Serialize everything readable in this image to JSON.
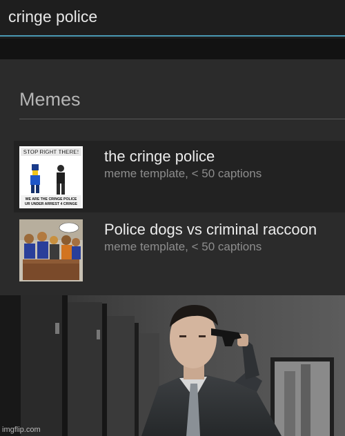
{
  "search": {
    "value": "cringe police"
  },
  "section": {
    "title": "Memes"
  },
  "results": [
    {
      "title": "the cringe police",
      "subtitle": "meme template, < 50 captions",
      "thumbnail": {
        "top_text": "STOP RIGHT THERE!",
        "bottom_text_1": "WE ARE THE CRINGE POLICE",
        "bottom_text_2": "UR UNDER ARREST 4 CRINGE"
      }
    },
    {
      "title": "Police dogs vs criminal raccoon",
      "subtitle": "meme template, < 50 captions"
    }
  ],
  "image": {
    "watermark": "imgflip.com"
  },
  "colors": {
    "accent": "#4a9ab4",
    "dropdown_bg": "#2b2b2b",
    "row_highlight": "#222222"
  }
}
